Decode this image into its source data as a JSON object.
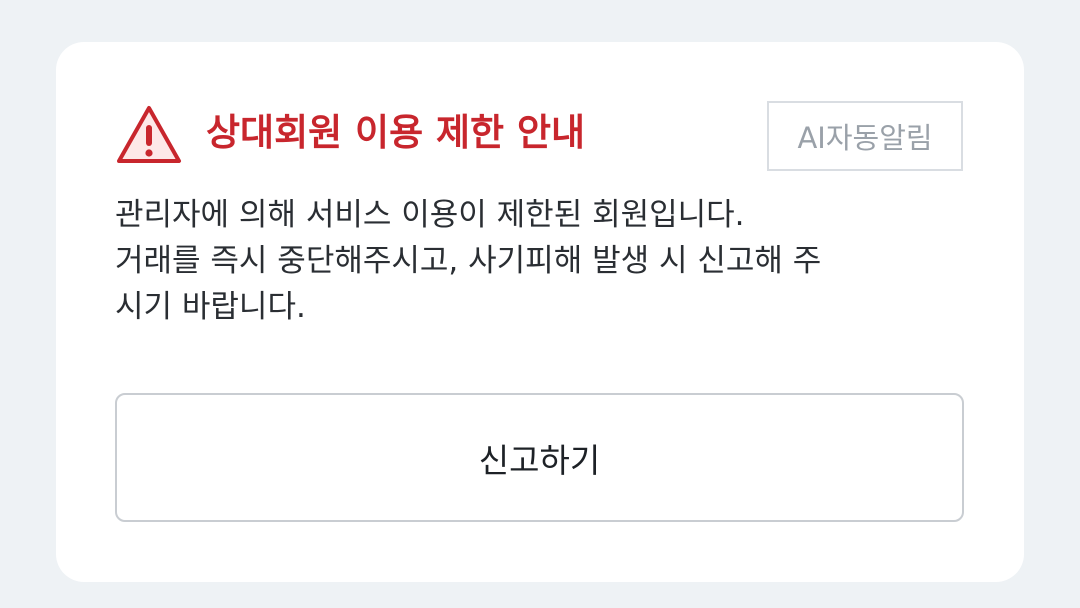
{
  "notice": {
    "title": "상대회원 이용 제한 안내",
    "badge": "AI자동알림",
    "lines": [
      "관리자에 의해 서비스 이용이 제한된 회원입니다.",
      "거래를 즉시 중단해주시고, 사기피해 발생 시 신고해 주",
      "시기 바랍니다."
    ],
    "report_button_label": "신고하기",
    "icon": "warning-triangle-icon",
    "colors": {
      "accent": "#c8262d",
      "background": "#eef2f5",
      "badge_text": "#9aa1a9"
    }
  }
}
